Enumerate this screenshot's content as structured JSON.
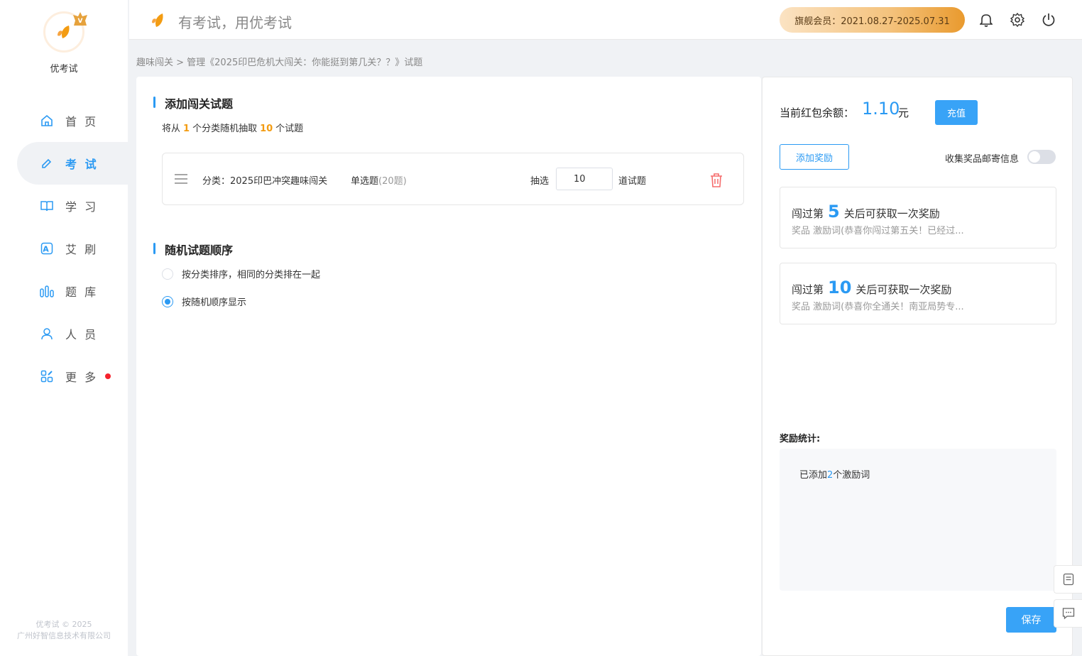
{
  "app": {
    "name": "优考试",
    "slogan": "有考试，用优考试",
    "copyright_line1": "优考试 © 2025",
    "copyright_line2": "广州好智信息技术有限公司"
  },
  "header": {
    "member": "旗舰会员：2021.08.27-2025.07.31"
  },
  "nav": [
    {
      "label": "首 页",
      "icon": "home-icon"
    },
    {
      "label": "考 试",
      "icon": "exam-icon",
      "active": true
    },
    {
      "label": "学 习",
      "icon": "book-icon"
    },
    {
      "label": "艾 刷",
      "icon": "a-icon"
    },
    {
      "label": "题 库",
      "icon": "bank-icon"
    },
    {
      "label": "人 员",
      "icon": "user-icon"
    },
    {
      "label": "更 多",
      "icon": "more-icon"
    }
  ],
  "breadcrumb": "趣味闯关 > 管理《2025印巴危机大闯关：你能挺到第几关？？》试题",
  "main": {
    "add_title": "添加闯关试题",
    "desc_prefix": "将从",
    "desc_cat_count": "1",
    "desc_mid": "个分类随机抽取",
    "desc_q_count": "10",
    "desc_suffix": "个试题",
    "category": {
      "label": "分类：2025印巴冲突趣味闯关",
      "type": "单选题",
      "count": "(20题)",
      "pick_label": "抽选",
      "pick_value": "10",
      "pick_suffix": "道试题"
    },
    "order_title": "随机试题顺序",
    "order_options": [
      {
        "label": "按分类排序，相同的分类排在一起",
        "checked": false
      },
      {
        "label": "按随机顺序显示",
        "checked": true
      }
    ]
  },
  "right": {
    "balance_label": "当前红包余额：",
    "balance_value": "1.10",
    "balance_unit": "元",
    "recharge": "充值",
    "add_reward": "添加奖励",
    "collect_label": "收集奖品邮寄信息",
    "collect_on": false,
    "rewards": [
      {
        "prefix": "闯过第",
        "level": "5",
        "suffix": "关后可获取一次奖励",
        "sub": "奖品 激励词(恭喜你闯过第五关！已经过..."
      },
      {
        "prefix": "闯过第",
        "level": "10",
        "suffix": "关后可获取一次奖励",
        "sub": "奖品 激励词(恭喜你全通关！南亚局势专..."
      }
    ],
    "stats_label": "奖励统计:",
    "stats_prefix": "已添加",
    "stats_count": "2",
    "stats_suffix": "个激励词",
    "save": "保存"
  },
  "colors": {
    "accent": "#2b9af3",
    "orange": "#f39c12",
    "danger": "#f56c6c"
  }
}
